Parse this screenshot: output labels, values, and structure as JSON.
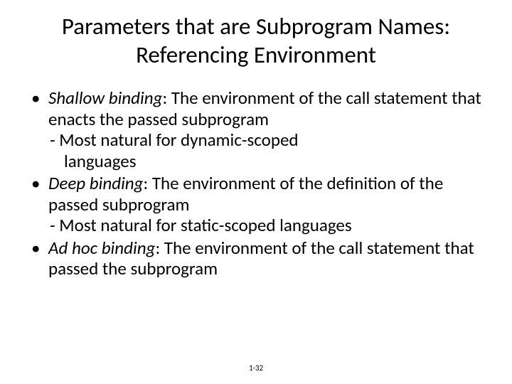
{
  "title": "Parameters that are Subprogram Names: Referencing Environment",
  "bullets": [
    {
      "term": "Shallow binding",
      "desc": ": The environment of the call statement that enacts the passed subprogram",
      "sub1": "- Most natural for dynamic-scoped",
      "sub2": "languages"
    },
    {
      "term": "Deep binding",
      "desc": ": The environment of the definition of the passed subprogram",
      "sub1": "- Most natural for static-scoped languages",
      "sub2": ""
    },
    {
      "term": "Ad hoc binding",
      "desc": ": The environment of the call statement that passed the subprogram",
      "sub1": "",
      "sub2": ""
    }
  ],
  "footer": "1-32"
}
